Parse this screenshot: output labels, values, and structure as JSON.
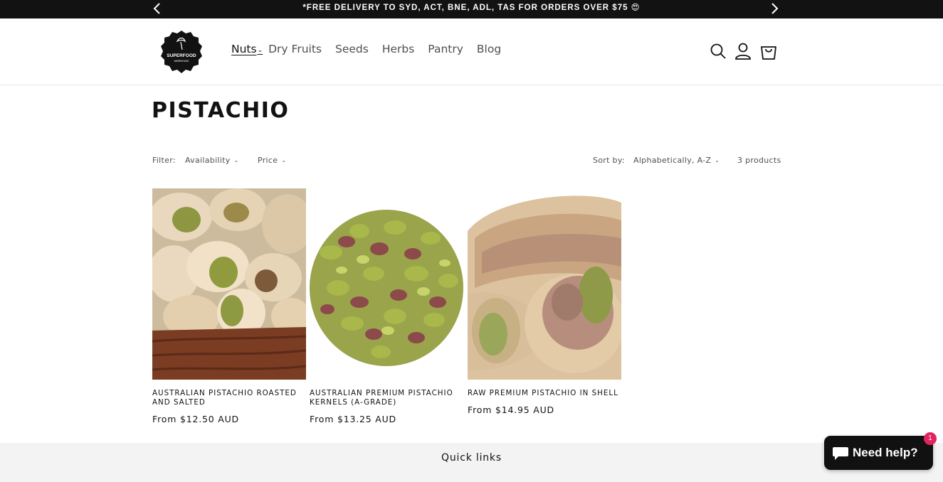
{
  "announcement": {
    "text": "*FREE DELIVERY TO SYD, ACT, BNE, ADL, TAS FOR ORDERS OVER $75 😍"
  },
  "header": {
    "logo_text": "SUPERFOOD",
    "logo_subtext": "WAREHOUSE",
    "nav": [
      {
        "label": "Nuts",
        "active": true,
        "has_dropdown": true
      },
      {
        "label": "Dry Fruits"
      },
      {
        "label": "Seeds"
      },
      {
        "label": "Herbs"
      },
      {
        "label": "Pantry"
      },
      {
        "label": "Blog"
      }
    ],
    "icons": [
      "search-icon",
      "account-icon",
      "cart-icon"
    ]
  },
  "collection": {
    "title": "PISTACHIO"
  },
  "filters": {
    "filter_label": "Filter:",
    "availability": "Availability",
    "price": "Price",
    "sort_label": "Sort by:",
    "sort_value": "Alphabetically, A-Z",
    "count": "3 products"
  },
  "products": [
    {
      "title": "AUSTRALIAN PISTACHIO ROASTED AND SALTED",
      "price": "From $12.50 AUD"
    },
    {
      "title": "AUSTRALIAN PREMIUM PISTACHIO KERNELS (A-GRADE)",
      "price": "From $13.25 AUD"
    },
    {
      "title": "RAW PREMIUM PISTACHIO IN SHELL",
      "price": "From $14.95 AUD"
    }
  ],
  "footer": {
    "quick_links_title": "Quick links"
  },
  "chat": {
    "label": "Need help?",
    "badge": "1"
  },
  "colors": {
    "announcement_bg": "#121212",
    "text": "#121212",
    "footer_bg": "#f3f3f3",
    "chat_bg": "#111111",
    "badge": "#e0245e"
  }
}
